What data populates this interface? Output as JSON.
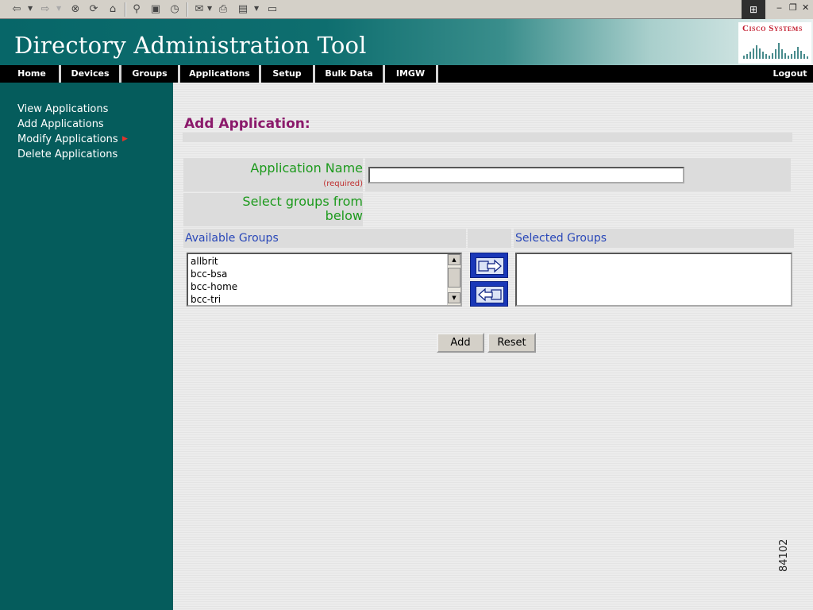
{
  "app": {
    "title": "Directory Administration Tool",
    "logo_text": "Cisco Systems"
  },
  "nav": {
    "items": [
      "Home",
      "Devices",
      "Groups",
      "Applications",
      "Setup",
      "Bulk Data",
      "IMGW"
    ],
    "logout": "Logout"
  },
  "sidebar": {
    "links": [
      "View Applications",
      "Add Applications",
      "Modify Applications",
      "Delete Applications"
    ],
    "submenu_arrow": "▶"
  },
  "form": {
    "title": "Add Application:",
    "app_name_label": "Application Name",
    "required_note": "(required)",
    "app_name_value": "",
    "select_groups_label": "Select groups from below",
    "available_groups_label": "Available Groups",
    "selected_groups_label": "Selected Groups",
    "available_groups": [
      "allbrit",
      "bcc-bsa",
      "bcc-home",
      "bcc-tri"
    ],
    "selected_groups": [],
    "add_label": "Add",
    "reset_label": "Reset"
  },
  "figure_id": "84102",
  "colors": {
    "sidebar": "#055c5c",
    "title": "#8b1a6b",
    "label_green": "#1d9a1d",
    "group_blue": "#2a48b8",
    "move_button": "#1a38b8"
  }
}
